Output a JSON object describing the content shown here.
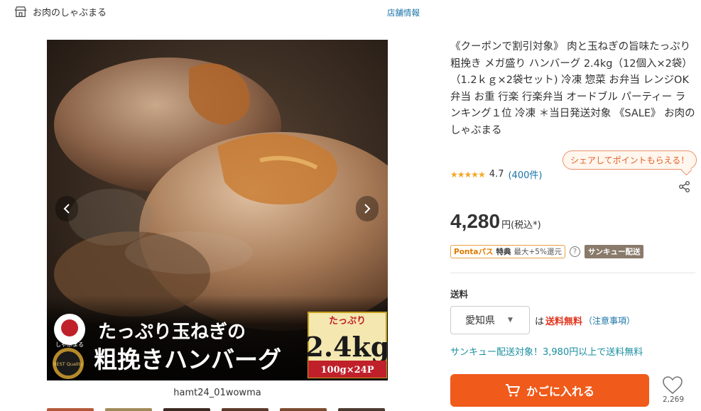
{
  "store": {
    "name": "お肉のしゃぶまる",
    "icon": "store-icon",
    "info_link": "店舗情報"
  },
  "gallery": {
    "caption": "hamt24_01wowma",
    "prev_icon": "chevron-left-icon",
    "next_icon": "chevron-right-icon",
    "overlay": {
      "brand_text": "しゃぶまる",
      "badge_text": "BEST Quality",
      "tag_text": "たっぷり",
      "weight_text": "2.4kg",
      "pack_text": "100g×24P",
      "headline_line1": "たっぷり玉ねぎの",
      "headline_line2": "粗挽きハンバーグ"
    },
    "thumb_colors": [
      "#b5583a",
      "#a08a5a",
      "#3a2a22",
      "#5a3a2a",
      "#7a4a30",
      "#4a3a30"
    ]
  },
  "product": {
    "title": "《クーポンで割引対象》 肉と玉ねぎの旨味たっぷり 粗挽き メガ盛り ハンバーグ 2.4kg（12個入×2袋）（1.2ｋｇ×2袋セット) 冷凍 惣菜 お弁当 レンジOK 弁当 お重 行楽 行楽弁当 オードブル パーティー ランキング１位 冷凍 ＊当日発送対象 《SALE》 お肉の しゃぶまる",
    "stars": "★★★★★",
    "rating": "4.7",
    "review_count": "(400件)",
    "share_bubble": "シェアしてポイントもらえる！",
    "share_icon": "share-icon",
    "price": "4,280",
    "price_unit": "円(税込*)",
    "ponta_name": "Pontaパス",
    "ponta_label": "特典",
    "ponta_detail": "最大+5%還元",
    "help_icon": "?",
    "thankyou_badge": "サンキュー配送"
  },
  "shipping": {
    "label": "送料",
    "prefecture": "愛知県",
    "prefix": "は",
    "free_text": "送料無料",
    "note_link": "（注意事項）",
    "thankyou_text": "サンキュー配送対象！3,980円以上で送料無料"
  },
  "actions": {
    "cart_label": "かごに入れる",
    "cart_icon": "cart-icon",
    "fav_icon": "heart-icon",
    "fav_count": "2,269"
  },
  "colors": {
    "accent": "#f05a1a",
    "link": "#1a73a8",
    "free": "#e0341c",
    "star": "#f5a623"
  }
}
